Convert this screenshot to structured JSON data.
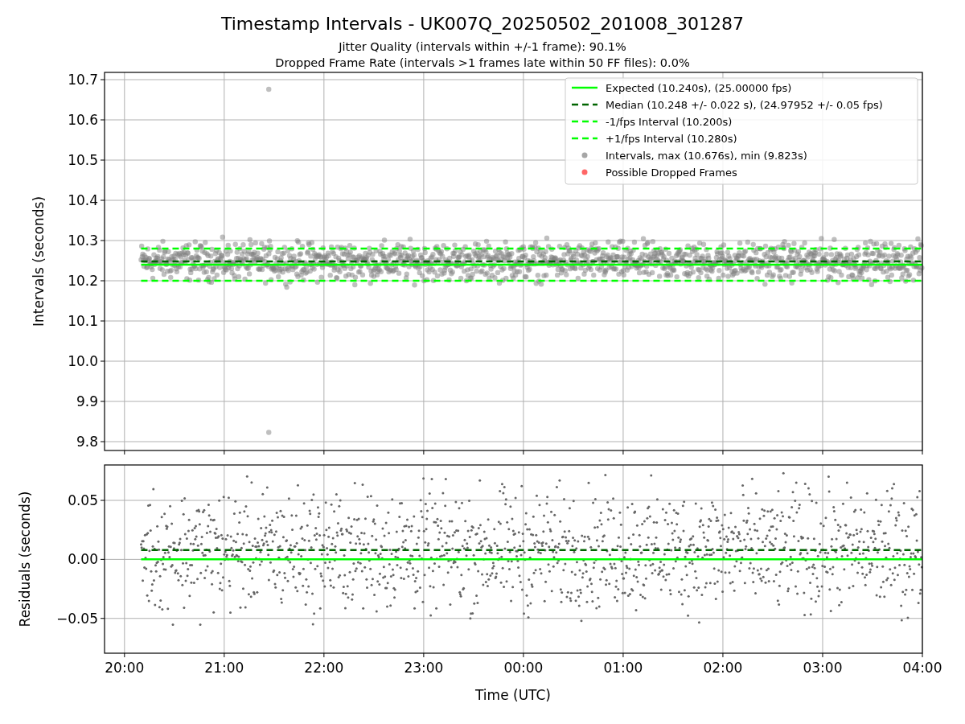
{
  "figure": {
    "title": "Timestamp Intervals - UK007Q_20250502_201008_301287",
    "subtitles": [
      "Jitter Quality (intervals within +/-1 frame): 90.1%",
      "Dropped Frame Rate (intervals >1 frames late within 50 FF files): 0.0%"
    ]
  },
  "interval_plot": {
    "chart_data": {
      "type": "line",
      "ylabel": "Intervals (seconds)",
      "grid": true,
      "legend": "upper right",
      "x": [
        "2025-05-02T20:10",
        "2025-05-03T04:00"
      ],
      "xlim": [
        "2025-05-02T19:48",
        "2025-05-03T04:00"
      ],
      "ylim": [
        9.778,
        10.718
      ],
      "yticks": [
        {
          "value": 9.8,
          "label": "9.8"
        },
        {
          "value": 9.9,
          "label": "9.9"
        },
        {
          "value": 10.0,
          "label": "10.0"
        },
        {
          "value": 10.1,
          "label": "10.1"
        },
        {
          "value": 10.2,
          "label": "10.2"
        },
        {
          "value": 10.3,
          "label": "10.3"
        },
        {
          "value": 10.4,
          "label": "10.4"
        },
        {
          "value": 10.5,
          "label": "10.5"
        },
        {
          "value": 10.6,
          "label": "10.6"
        },
        {
          "value": 10.7,
          "label": "10.7"
        }
      ],
      "series": [
        {
          "name": "Expected (10.240s), (25.00000 fps)",
          "color": "#00ff00",
          "line_style": "solid",
          "values": [
            10.24,
            10.24
          ]
        },
        {
          "name": "Median (10.248 +/- 0.022 s), (24.97952 +/- 0.05 fps)",
          "color": "#006400",
          "line_style": "dashed",
          "values": [
            10.248,
            10.248
          ]
        },
        {
          "name": "-1/fps Interval (10.200s)",
          "color": "#00ff00",
          "line_style": "dashed",
          "values": [
            10.2,
            10.2
          ]
        },
        {
          "name": "+1/fps Interval (10.280s)",
          "color": "#00ff00",
          "line_style": "dashed",
          "values": [
            10.28,
            10.28
          ]
        }
      ]
    },
    "markers": [
      {
        "label": "Intervals, max (10.676s), min (9.823s)",
        "color": "#a6a6a6"
      },
      {
        "label": "Possible Dropped Frames",
        "color": "#ff6666"
      }
    ]
  },
  "residual_plot": {
    "chart_data": {
      "type": "line",
      "xlabel": "Time (UTC)",
      "ylabel": "Residuals (seconds)",
      "grid": true,
      "x": [
        "2025-05-02T20:10",
        "2025-05-03T04:00"
      ],
      "xlim": [
        "2025-05-02T19:48",
        "2025-05-03T04:00"
      ],
      "ylim": [
        -0.0795,
        0.08
      ],
      "xticks": [
        {
          "value": "2025-05-02T20:00",
          "label": "20:00"
        },
        {
          "value": "2025-05-02T21:00",
          "label": "21:00"
        },
        {
          "value": "2025-05-02T22:00",
          "label": "22:00"
        },
        {
          "value": "2025-05-02T23:00",
          "label": "23:00"
        },
        {
          "value": "2025-05-03T00:00",
          "label": "00:00"
        },
        {
          "value": "2025-05-03T01:00",
          "label": "01:00"
        },
        {
          "value": "2025-05-03T02:00",
          "label": "02:00"
        },
        {
          "value": "2025-05-03T03:00",
          "label": "03:00"
        },
        {
          "value": "2025-05-03T04:00",
          "label": "04:00"
        }
      ],
      "yticks": [
        {
          "value": -0.05,
          "label": "−0.05"
        },
        {
          "value": 0,
          "label": "0.00"
        },
        {
          "value": 0.05,
          "label": "0.05"
        }
      ],
      "series": [
        {
          "color": "#00ff00",
          "line_style": "solid",
          "values": [
            0,
            0
          ]
        },
        {
          "color": "#006400",
          "line_style": "dashed",
          "values": [
            0.008,
            0.008
          ]
        }
      ]
    }
  }
}
